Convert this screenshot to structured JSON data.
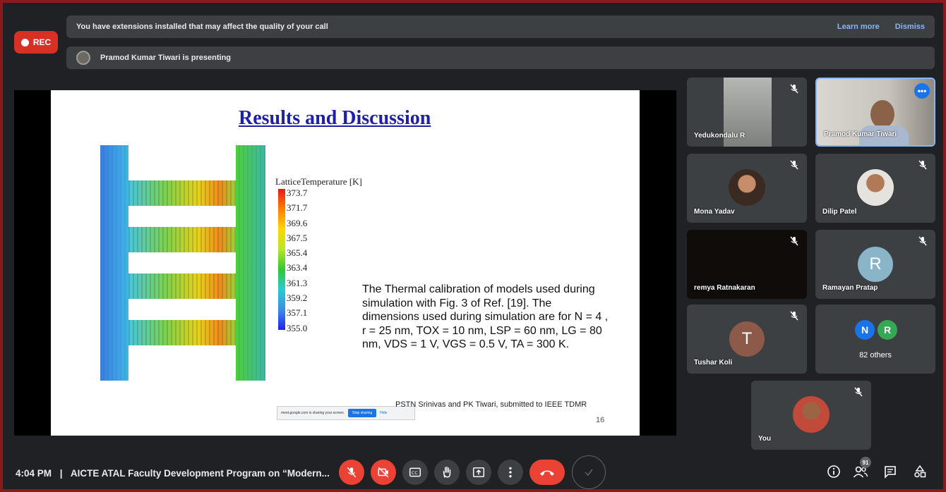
{
  "recording": {
    "label": "REC"
  },
  "banners": {
    "extensions": {
      "text": "You have extensions installed that may affect the quality of your call",
      "learn_more": "Learn more",
      "dismiss": "Dismiss"
    },
    "presenting": {
      "text": "Pramod Kumar Tiwari is presenting"
    }
  },
  "slide": {
    "title": "Results and Discussion",
    "legend_title": "LatticeTemperature [K]",
    "legend_ticks": [
      "373.7",
      "371.7",
      "369.6",
      "367.5",
      "365.4",
      "363.4",
      "361.3",
      "359.2",
      "357.1",
      "355.0"
    ],
    "body_text": "The Thermal calibration of models used during simulation with Fig. 3 of Ref. [19]. The dimensions used during simulation are for N = 4 , r = 25 nm, TOX = 10 nm, LSP = 60 nm, LG = 80 nm, VDS = 1 V, VGS = 0.5 V, TA = 300 K.",
    "citation": "PSTN Srinivas and PK Tiwari, submitted to IEEE TDMR",
    "page_number": "16",
    "share_bar": {
      "message": "meet.google.com is sharing your screen.",
      "stop": "Stop sharing",
      "hide": "Hide"
    }
  },
  "participants": [
    {
      "name": "Yedukondalu R",
      "muted": true
    },
    {
      "name": "Pramod Kumar Tiwari",
      "muted": false,
      "active": true
    },
    {
      "name": "Mona Yadav",
      "muted": true
    },
    {
      "name": "Dilip Patel",
      "muted": true
    },
    {
      "name": "remya Ratnakaran",
      "muted": true
    },
    {
      "name": "Ramayan Pratap",
      "muted": true,
      "initial": "R",
      "color": "#8ab4c8"
    },
    {
      "name": "Tushar Koli",
      "muted": true,
      "initial": "T",
      "color": "#8d5a4a"
    },
    {
      "name": "82 others",
      "initials": [
        "N",
        "R"
      ],
      "colors": [
        "#1a73e8",
        "#34a853"
      ]
    },
    {
      "name": "You",
      "muted": true
    }
  ],
  "footer": {
    "time": "4:04 PM",
    "separator": "|",
    "meeting_title": "AICTE ATAL Faculty Development Program on “Modern...",
    "participant_count": "91"
  },
  "controls": [
    {
      "name": "mic-off-icon",
      "style": "red"
    },
    {
      "name": "camera-off-icon",
      "style": "red"
    },
    {
      "name": "captions-icon",
      "style": "gray"
    },
    {
      "name": "raise-hand-icon",
      "style": "gray"
    },
    {
      "name": "present-icon",
      "style": "gray"
    },
    {
      "name": "more-options-icon",
      "style": "gray"
    },
    {
      "name": "hang-up-icon",
      "style": "hangup"
    }
  ],
  "colors": {
    "accent": "#8ab4f8",
    "danger": "#ea4335",
    "surface": "#3c4043",
    "background": "#202124"
  }
}
